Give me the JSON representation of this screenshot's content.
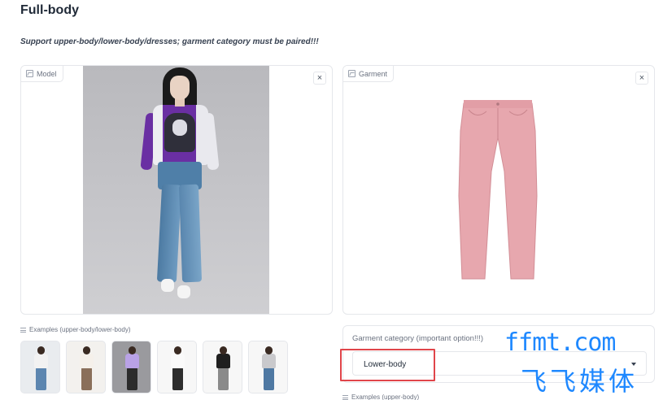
{
  "header": {
    "title": "Full-body",
    "subtitle": "Support upper-body/lower-body/dresses; garment category must be paired!!!"
  },
  "model_panel": {
    "label": "Model",
    "close_glyph": "×",
    "icon": "image-icon"
  },
  "garment_panel": {
    "label": "Garment",
    "close_glyph": "×",
    "icon": "image-icon"
  },
  "examples": {
    "label": "Examples (upper-body/lower-body)",
    "thumbs": [
      {
        "top": "#f2f2f2",
        "legs": "#5c86b0",
        "bg": "#e9ecef"
      },
      {
        "top": "#f5f0ea",
        "legs": "#8a6f5a",
        "bg": "#f3f1ee"
      },
      {
        "top": "#b9a2e6",
        "legs": "#2b2b2b",
        "bg": "#9a9a9e"
      },
      {
        "top": "#fafafa",
        "legs": "#2d2d2d",
        "bg": "#f7f7f7"
      },
      {
        "top": "#1f1f1f",
        "legs": "#8a8a8a",
        "bg": "#f7f7f7"
      },
      {
        "top": "#c9c9cc",
        "legs": "#4f79a3",
        "bg": "#f7f7f7"
      }
    ]
  },
  "category": {
    "label": "Garment category (important option!!!)",
    "selected": "Lower-body"
  },
  "examples_garment": {
    "label": "Examples (upper-body)"
  },
  "watermark": {
    "line1": "ffmt.com",
    "line2": "飞飞媒体"
  },
  "colors": {
    "highlight": "#e0454a",
    "watermark": "#1e88ff",
    "border": "#e5e7eb"
  }
}
